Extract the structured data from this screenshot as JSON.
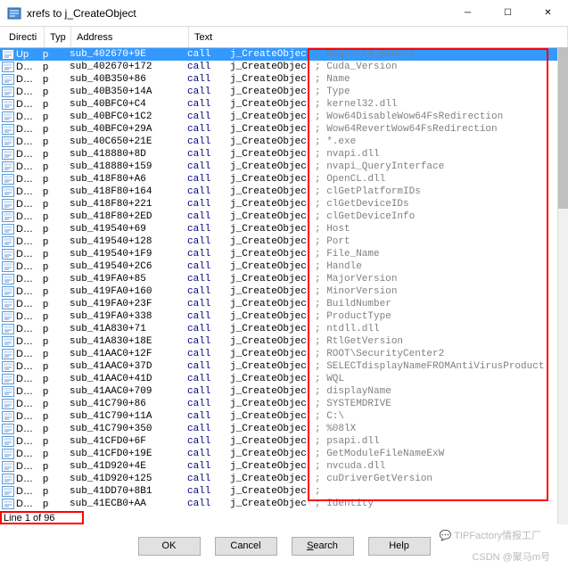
{
  "title": "xrefs to j_CreateObject",
  "columns": {
    "direction": "Directi",
    "type": "Typ",
    "address": "Address",
    "text": "Text"
  },
  "status": "Line 1 of 96",
  "buttons": {
    "ok": "OK",
    "cancel": "Cancel",
    "search": "Search",
    "help": "Help"
  },
  "watermark1": "💬 TIPFactory情报工厂",
  "watermark2": "CSDN @聚马m号",
  "rows": [
    {
      "dir": "Up",
      "typ": "p",
      "addr": "sub_402670+9E",
      "t1": "call",
      "t2": "j_CreateObjec",
      "t3": "Required_Binary",
      "sel": true
    },
    {
      "dir": "D…",
      "typ": "p",
      "addr": "sub_402670+172",
      "t1": "call",
      "t2": "j_CreateObjec",
      "t3": "Cuda_Version"
    },
    {
      "dir": "D…",
      "typ": "p",
      "addr": "sub_40B350+86",
      "t1": "call",
      "t2": "j_CreateObjec",
      "t3": "Name"
    },
    {
      "dir": "D…",
      "typ": "p",
      "addr": "sub_40B350+14A",
      "t1": "call",
      "t2": "j_CreateObjec",
      "t3": "Type"
    },
    {
      "dir": "D…",
      "typ": "p",
      "addr": "sub_40BFC0+C4",
      "t1": "call",
      "t2": "j_CreateObjec",
      "t3": "kernel32.dll"
    },
    {
      "dir": "D…",
      "typ": "p",
      "addr": "sub_40BFC0+1C2",
      "t1": "call",
      "t2": "j_CreateObjec",
      "t3": "Wow64DisableWow64FsRedirection"
    },
    {
      "dir": "D…",
      "typ": "p",
      "addr": "sub_40BFC0+29A",
      "t1": "call",
      "t2": "j_CreateObjec",
      "t3": "Wow64RevertWow64FsRedirection"
    },
    {
      "dir": "D…",
      "typ": "p",
      "addr": "sub_40C650+21E",
      "t1": "call",
      "t2": "j_CreateObjec",
      "t3": "*.exe"
    },
    {
      "dir": "D…",
      "typ": "p",
      "addr": "sub_418880+8D",
      "t1": "call",
      "t2": "j_CreateObjec",
      "t3": "nvapi.dll"
    },
    {
      "dir": "D…",
      "typ": "p",
      "addr": "sub_418880+159",
      "t1": "call",
      "t2": "j_CreateObjec",
      "t3": "nvapi_QueryInterface"
    },
    {
      "dir": "D…",
      "typ": "p",
      "addr": "sub_418F80+A6",
      "t1": "call",
      "t2": "j_CreateObjec",
      "t3": "OpenCL.dll"
    },
    {
      "dir": "D…",
      "typ": "p",
      "addr": "sub_418F80+164",
      "t1": "call",
      "t2": "j_CreateObjec",
      "t3": "clGetPlatformIDs"
    },
    {
      "dir": "D…",
      "typ": "p",
      "addr": "sub_418F80+221",
      "t1": "call",
      "t2": "j_CreateObjec",
      "t3": "clGetDeviceIDs"
    },
    {
      "dir": "D…",
      "typ": "p",
      "addr": "sub_418F80+2ED",
      "t1": "call",
      "t2": "j_CreateObjec",
      "t3": "clGetDeviceInfo"
    },
    {
      "dir": "D…",
      "typ": "p",
      "addr": "sub_419540+69",
      "t1": "call",
      "t2": "j_CreateObjec",
      "t3": "Host"
    },
    {
      "dir": "D…",
      "typ": "p",
      "addr": "sub_419540+128",
      "t1": "call",
      "t2": "j_CreateObjec",
      "t3": "Port"
    },
    {
      "dir": "D…",
      "typ": "p",
      "addr": "sub_419540+1F9",
      "t1": "call",
      "t2": "j_CreateObjec",
      "t3": "File_Name"
    },
    {
      "dir": "D…",
      "typ": "p",
      "addr": "sub_419540+2C6",
      "t1": "call",
      "t2": "j_CreateObjec",
      "t3": "Handle"
    },
    {
      "dir": "D…",
      "typ": "p",
      "addr": "sub_419FA0+85",
      "t1": "call",
      "t2": "j_CreateObjec",
      "t3": "MajorVersion"
    },
    {
      "dir": "D…",
      "typ": "p",
      "addr": "sub_419FA0+160",
      "t1": "call",
      "t2": "j_CreateObjec",
      "t3": "MinorVersion"
    },
    {
      "dir": "D…",
      "typ": "p",
      "addr": "sub_419FA0+23F",
      "t1": "call",
      "t2": "j_CreateObjec",
      "t3": "BuildNumber"
    },
    {
      "dir": "D…",
      "typ": "p",
      "addr": "sub_419FA0+338",
      "t1": "call",
      "t2": "j_CreateObjec",
      "t3": "ProductType"
    },
    {
      "dir": "D…",
      "typ": "p",
      "addr": "sub_41A830+71",
      "t1": "call",
      "t2": "j_CreateObjec",
      "t3": "ntdll.dll"
    },
    {
      "dir": "D…",
      "typ": "p",
      "addr": "sub_41A830+18E",
      "t1": "call",
      "t2": "j_CreateObjec",
      "t3": "RtlGetVersion"
    },
    {
      "dir": "D…",
      "typ": "p",
      "addr": "sub_41AAC0+12F",
      "t1": "call",
      "t2": "j_CreateObjec",
      "t3": "ROOT\\SecurityCenter2"
    },
    {
      "dir": "D…",
      "typ": "p",
      "addr": "sub_41AAC0+37D",
      "t1": "call",
      "t2": "j_CreateObjec",
      "t3": "SELECTdisplayNameFROMAntiVirusProduct"
    },
    {
      "dir": "D…",
      "typ": "p",
      "addr": "sub_41AAC0+41D",
      "t1": "call",
      "t2": "j_CreateObjec",
      "t3": "WQL"
    },
    {
      "dir": "D…",
      "typ": "p",
      "addr": "sub_41AAC0+709",
      "t1": "call",
      "t2": "j_CreateObjec",
      "t3": "displayName"
    },
    {
      "dir": "D…",
      "typ": "p",
      "addr": "sub_41C790+86",
      "t1": "call",
      "t2": "j_CreateObjec",
      "t3": "SYSTEMDRIVE"
    },
    {
      "dir": "D…",
      "typ": "p",
      "addr": "sub_41C790+11A",
      "t1": "call",
      "t2": "j_CreateObjec",
      "t3": "C:\\"
    },
    {
      "dir": "D…",
      "typ": "p",
      "addr": "sub_41C790+350",
      "t1": "call",
      "t2": "j_CreateObjec",
      "t3": "%08lX"
    },
    {
      "dir": "D…",
      "typ": "p",
      "addr": "sub_41CFD0+6F",
      "t1": "call",
      "t2": "j_CreateObjec",
      "t3": "psapi.dll"
    },
    {
      "dir": "D…",
      "typ": "p",
      "addr": "sub_41CFD0+19E",
      "t1": "call",
      "t2": "j_CreateObjec",
      "t3": "GetModuleFileNameExW"
    },
    {
      "dir": "D…",
      "typ": "p",
      "addr": "sub_41D920+4E",
      "t1": "call",
      "t2": "j_CreateObjec",
      "t3": "nvcuda.dll"
    },
    {
      "dir": "D…",
      "typ": "p",
      "addr": "sub_41D920+125",
      "t1": "call",
      "t2": "j_CreateObjec",
      "t3": "cuDriverGetVersion"
    },
    {
      "dir": "D…",
      "typ": "p",
      "addr": "sub_41DD70+8B1",
      "t1": "call",
      "t2": "j_CreateObjec",
      "t3": ""
    },
    {
      "dir": "D…",
      "typ": "p",
      "addr": "sub_41ECB0+AA",
      "t1": "call",
      "t2": "j_CreateObjec",
      "t3": "Identity"
    }
  ]
}
